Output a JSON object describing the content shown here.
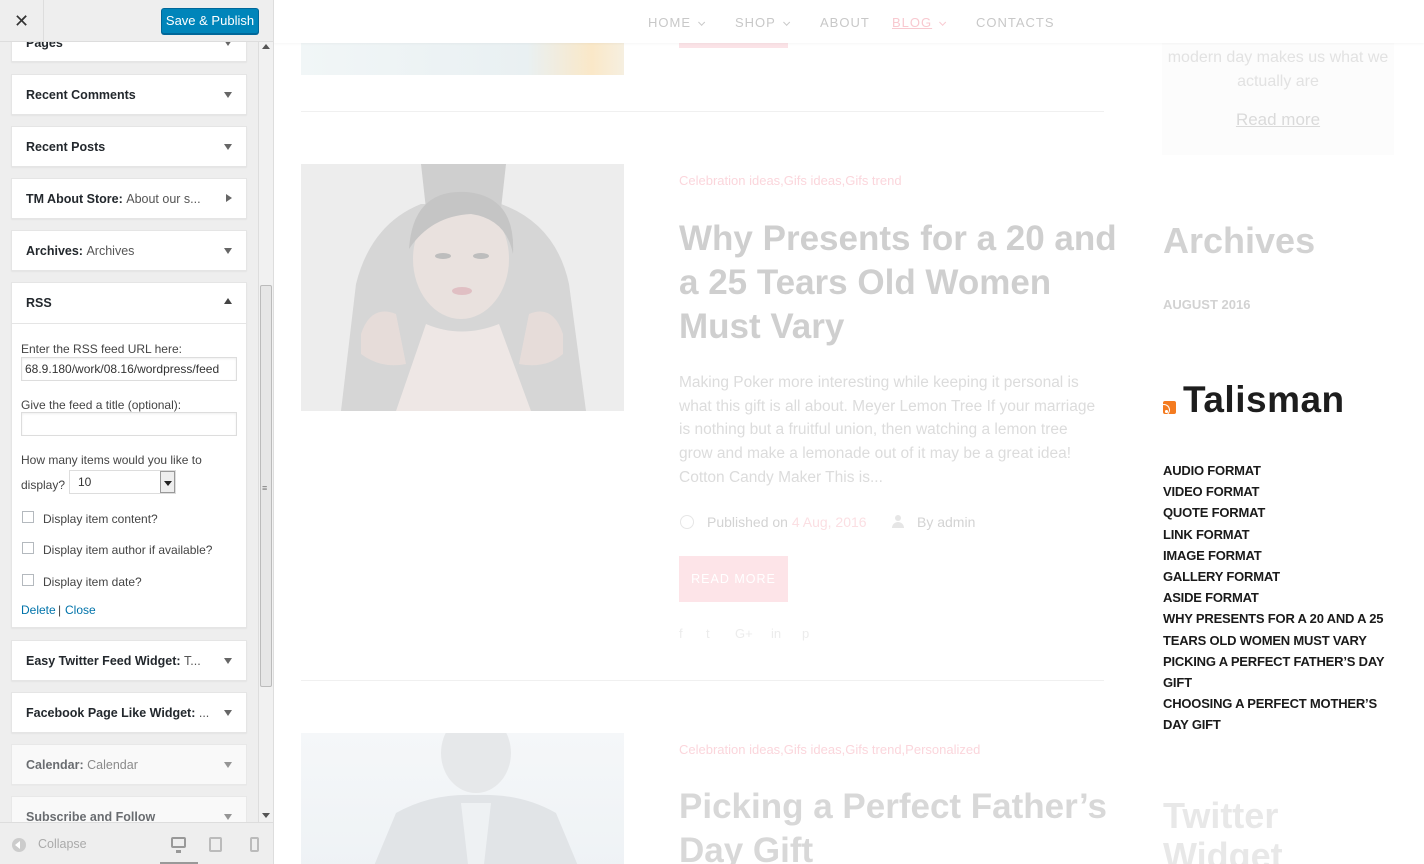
{
  "customizer": {
    "close_glyph": "✕",
    "save_label": "Save & Publish",
    "widgets": [
      {
        "title": "Pages",
        "subtitle": ""
      },
      {
        "title": "Recent Comments",
        "subtitle": ""
      },
      {
        "title": "Recent Posts",
        "subtitle": ""
      },
      {
        "title": "TM About Store:",
        "subtitle": "About our s..."
      },
      {
        "title": "Archives:",
        "subtitle": "Archives"
      },
      {
        "title": "RSS",
        "subtitle": ""
      },
      {
        "title": "Easy Twitter Feed Widget:",
        "subtitle": "T..."
      },
      {
        "title": "Facebook Page Like Widget:",
        "subtitle": "..."
      },
      {
        "title": "Calendar:",
        "subtitle": "Calendar"
      },
      {
        "title": "Subscribe and Follow",
        "subtitle": ""
      }
    ],
    "rss_form": {
      "url_label": "Enter the RSS feed URL here:",
      "url_value": "68.9.180/work/08.16/wordpress/feed",
      "title_label": "Give the feed a title (optional):",
      "title_value": "",
      "items_label_1": "How many items would you like to",
      "items_label_2": "display?",
      "items_value": "10",
      "opt_content": "Display item content?",
      "opt_author": "Display item author if available?",
      "opt_date": "Display item date?",
      "delete_label": "Delete",
      "separator": "|",
      "close_label": "Close"
    },
    "footer": {
      "collapse_label": "Collapse",
      "grip": "≡"
    }
  },
  "preview": {
    "nav": [
      {
        "label": "HOME",
        "caret": true
      },
      {
        "label": "SHOP",
        "caret": true
      },
      {
        "label": "ABOUT",
        "caret": false
      },
      {
        "label": "BLOG",
        "caret": true,
        "active": true
      },
      {
        "label": "CONTACTS",
        "caret": false
      }
    ],
    "post1": {
      "categories": "Celebration ideas,Gifs ideas,Gifs trend",
      "title": "Why Presents for a 20 and a 25 Tears Old Women Must Vary",
      "excerpt": "Making Poker more interesting while keeping it personal is what this gift is all about. Meyer Lemon Tree If your marriage is nothing but a fruitful union, then watching a lemon tree grow and make a lemonade out of it may be a great idea!  Cotton Candy Maker This is...",
      "published_prefix": "Published on",
      "date": "4 Aug, 2016",
      "by_prefix": "By",
      "author": "admin",
      "read_more": "READ MORE",
      "social": [
        "f",
        "t",
        "G+",
        "in",
        "p"
      ]
    },
    "post2": {
      "categories": "Celebration ideas,Gifs ideas,Gifs trend,Personalized",
      "title": "Picking a Perfect Father’s Day Gift"
    },
    "sidebar": {
      "card_text": "modern day makes us what we actually are",
      "card_link": "Read more",
      "archives_title": "Archives",
      "archives_item": "AUGUST 2016",
      "rss_title": "Talisman",
      "rss_items": [
        "AUDIO FORMAT",
        "VIDEO FORMAT",
        "QUOTE FORMAT",
        "LINK FORMAT",
        "IMAGE FORMAT",
        "GALLERY FORMAT",
        "ASIDE FORMAT",
        "WHY PRESENTS FOR A 20 AND A 25 TEARS OLD WOMEN MUST VARY",
        "PICKING A PERFECT FATHER’S DAY GIFT",
        "CHOOSING A PERFECT MOTHER’S DAY GIFT"
      ],
      "twitter_title": "Twitter Widget"
    }
  }
}
